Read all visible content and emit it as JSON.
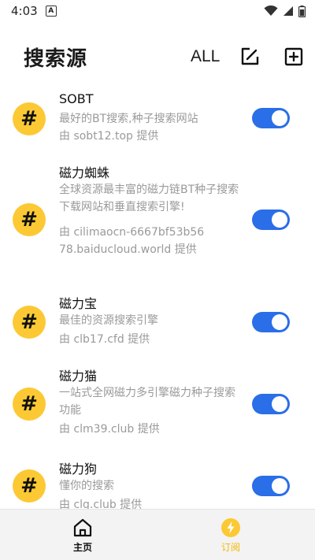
{
  "status_bar": {
    "time": "4:03",
    "notif_glyph": "A"
  },
  "header": {
    "title": "搜索源",
    "all_label": "ALL"
  },
  "sources": [
    {
      "name": "SOBT",
      "description": "最好的BT搜索,种子搜索网站",
      "provider": "由 sobt12.top 提供",
      "enabled": true,
      "icon_glyph": "#"
    },
    {
      "name": "磁力蜘蛛",
      "description": "全球资源最丰富的磁力链BT种子搜索下载网站和垂直搜索引擎!",
      "provider": "由 cilimaocn-6667bf53b5678.baiducloud.world 提供",
      "enabled": true,
      "icon_glyph": "#"
    },
    {
      "name": "磁力宝",
      "description": "最佳的资源搜索引擎",
      "provider": "由 clb17.cfd 提供",
      "enabled": true,
      "icon_glyph": "#"
    },
    {
      "name": "磁力猫",
      "description": "一站式全网磁力多引擎磁力种子搜索功能",
      "provider": "由 clm39.club 提供",
      "enabled": true,
      "icon_glyph": "#"
    },
    {
      "name": "磁力狗",
      "description": "懂你的搜索",
      "provider": "由 clg.club 提供",
      "enabled": true,
      "icon_glyph": "#"
    }
  ],
  "bottom_nav": {
    "home_label": "主页",
    "subscribe_label": "订阅",
    "active": "subscribe"
  },
  "colors": {
    "accent_blue": "#2a6ee8",
    "icon_yellow": "#fcc934",
    "active_nav": "#f5b700"
  }
}
